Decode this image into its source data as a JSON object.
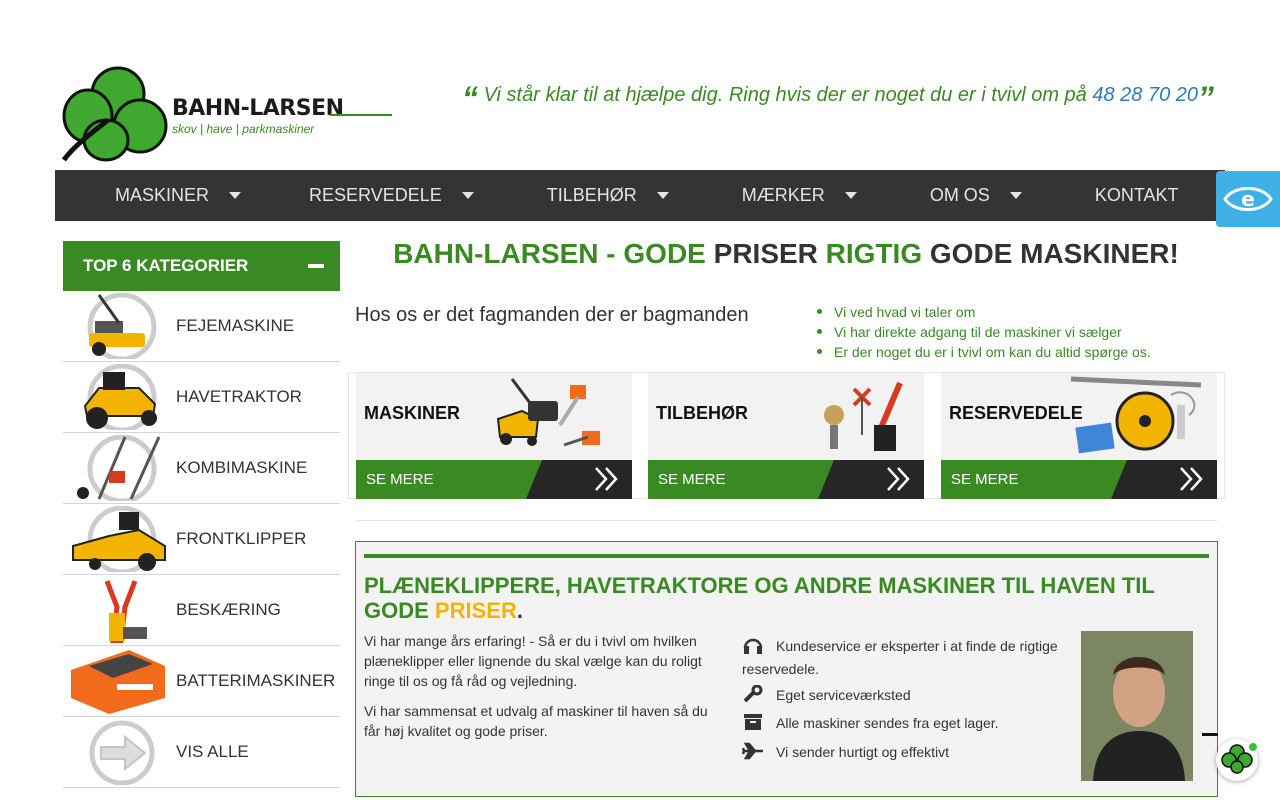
{
  "header": {
    "logo_name": "BAHN-LARSEN",
    "logo_tagline": "skov | have | parkmaskiner",
    "tagline_text": "Vi står klar til at hjælpe dig. Ring hvis der er noget du er i tvivl om på ",
    "tagline_phone": "48 28 70 20",
    "quote_open": "“",
    "quote_close": "”"
  },
  "nav": {
    "items": [
      {
        "label": "MASKINER",
        "dropdown": true
      },
      {
        "label": "RESERVEDELE",
        "dropdown": true
      },
      {
        "label": "TILBEHØR",
        "dropdown": true
      },
      {
        "label": "MÆRKER",
        "dropdown": true
      },
      {
        "label": "OM OS",
        "dropdown": true
      },
      {
        "label": "KONTAKT",
        "dropdown": false
      }
    ],
    "accessibility_icon": "eye-accessibility-icon"
  },
  "sidebar": {
    "title": "TOP 6 KATEGORIER",
    "items": [
      {
        "label": "FEJEMASKINE"
      },
      {
        "label": "HAVETRAKTOR"
      },
      {
        "label": "KOMBIMASKINE"
      },
      {
        "label": "FRONTKLIPPER"
      },
      {
        "label": "BESKÆRING"
      },
      {
        "label": "BATTERIMASKINER"
      },
      {
        "label": "VIS ALLE"
      }
    ]
  },
  "main": {
    "headline": {
      "p1": "BAHN-LARSEN - GODE",
      "p2": "PRISER",
      "p3": "RIGTIG",
      "p4": "GODE MASKINER!"
    },
    "subline": "Hos os er det fagmanden der er bagmanden",
    "bullets": [
      "Vi ved hvad vi taler om",
      "Vi har direkte adgang til de maskiner vi sælger",
      "Er der noget du er i tvivl om kan du altid spørge os."
    ],
    "cards": [
      {
        "title": "MASKINER",
        "more": "SE MERE"
      },
      {
        "title": "TILBEHØR",
        "more": "SE MERE"
      },
      {
        "title": "RESERVEDELE",
        "more": "SE MERE"
      }
    ],
    "info": {
      "title_main": "PLÆNEKLIPPERE, HAVETRAKTORE OG ANDRE MASKINER TIL HAVEN TIL GODE",
      "title_accent": "PRISER",
      "title_end": ".",
      "para1": "Vi har mange års erfaring! - Så er du i tvivl om hvilken plæneklipper eller lignende du skal vælge kan du roligt ringe til os og få råd og vejledning.",
      "para2": "Vi har sammensat et udvalg af maskiner til haven så du får høj kvalitet og gode priser.",
      "features": [
        {
          "icon": "headset-icon",
          "text": "Kundeservice er eksperter i at finde de rigtige reservedele."
        },
        {
          "icon": "wrench-icon",
          "text": "Eget serviceværksted"
        },
        {
          "icon": "archive-box-icon",
          "text": "Alle maskiner sendes fra eget lager."
        },
        {
          "icon": "plane-icon",
          "text": "Vi sender hurtigt og effektivt"
        }
      ]
    }
  },
  "colors": {
    "green": "#3a8a24",
    "dark": "#343434",
    "accent_yellow": "#f3b400",
    "phone_blue": "#2f7ab8",
    "accessibility_blue": "#3fb1e6"
  }
}
